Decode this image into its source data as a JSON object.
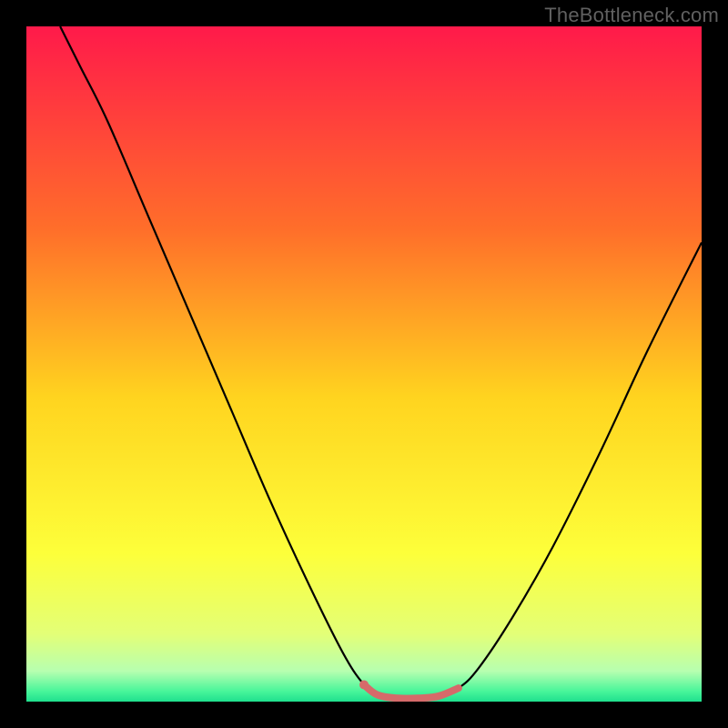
{
  "watermark": "TheBottleneck.com",
  "chart_data": {
    "type": "line",
    "title": "",
    "xlabel": "",
    "ylabel": "",
    "xlim": [
      0,
      100
    ],
    "ylim": [
      0,
      100
    ],
    "grid": false,
    "legend": false,
    "background_gradient": {
      "stops": [
        {
          "pos": 0.0,
          "color": "#ff1a4a"
        },
        {
          "pos": 0.3,
          "color": "#ff6e2a"
        },
        {
          "pos": 0.55,
          "color": "#ffd41f"
        },
        {
          "pos": 0.78,
          "color": "#fdff3a"
        },
        {
          "pos": 0.9,
          "color": "#e3ff77"
        },
        {
          "pos": 0.955,
          "color": "#b7ffb0"
        },
        {
          "pos": 0.985,
          "color": "#47f59a"
        },
        {
          "pos": 1.0,
          "color": "#1fe08e"
        }
      ]
    },
    "series": [
      {
        "name": "bottleneck-curve",
        "stroke": "#000000",
        "points": [
          {
            "x": 5.0,
            "y": 100.0
          },
          {
            "x": 8.0,
            "y": 94.0
          },
          {
            "x": 12.0,
            "y": 86.0
          },
          {
            "x": 18.0,
            "y": 72.0
          },
          {
            "x": 24.0,
            "y": 58.0
          },
          {
            "x": 30.0,
            "y": 44.0
          },
          {
            "x": 36.0,
            "y": 30.0
          },
          {
            "x": 42.0,
            "y": 17.0
          },
          {
            "x": 47.0,
            "y": 7.0
          },
          {
            "x": 50.0,
            "y": 2.5
          },
          {
            "x": 52.0,
            "y": 1.0
          },
          {
            "x": 55.0,
            "y": 0.5
          },
          {
            "x": 58.0,
            "y": 0.5
          },
          {
            "x": 61.0,
            "y": 0.8
          },
          {
            "x": 64.0,
            "y": 2.0
          },
          {
            "x": 67.0,
            "y": 5.0
          },
          {
            "x": 72.0,
            "y": 12.5
          },
          {
            "x": 78.0,
            "y": 23.0
          },
          {
            "x": 85.0,
            "y": 37.0
          },
          {
            "x": 92.0,
            "y": 52.0
          },
          {
            "x": 100.0,
            "y": 68.0
          }
        ]
      },
      {
        "name": "optimal-band",
        "stroke": "#d66a6a",
        "points": [
          {
            "x": 50.0,
            "y": 2.5
          },
          {
            "x": 52.0,
            "y": 1.0
          },
          {
            "x": 55.0,
            "y": 0.5
          },
          {
            "x": 58.0,
            "y": 0.5
          },
          {
            "x": 61.0,
            "y": 0.8
          },
          {
            "x": 64.0,
            "y": 2.0
          }
        ]
      }
    ],
    "markers": [
      {
        "x": 50.0,
        "y": 2.5,
        "color": "#d66a6a"
      }
    ]
  }
}
